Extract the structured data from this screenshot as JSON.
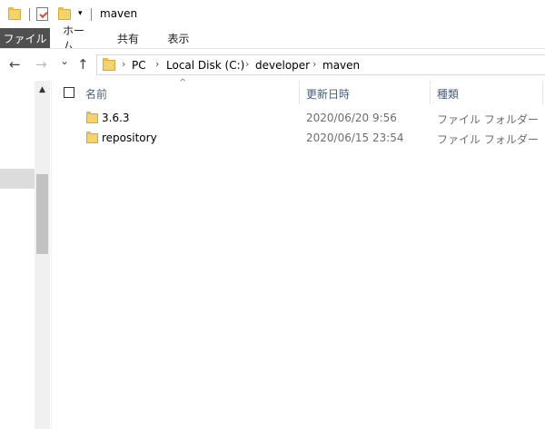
{
  "window": {
    "title": "maven",
    "quick_access_arrow": "▾"
  },
  "ribbon": {
    "tabs": [
      {
        "label": "ファイル"
      },
      {
        "label": "ホーム"
      },
      {
        "label": "共有"
      },
      {
        "label": "表示"
      }
    ]
  },
  "navigation": {
    "back_icon": "←",
    "forward_icon": "→",
    "recent_icon": "⌄",
    "up_icon": "↑",
    "breadcrumbs": [
      "PC",
      "Local Disk (C:)",
      "developer",
      "maven"
    ]
  },
  "list": {
    "columns": {
      "name": "名前",
      "modified": "更新日時",
      "type": "種類"
    },
    "sort_indicator": "^",
    "rows": [
      {
        "name": "3.6.3",
        "modified": "2020/06/20 9:56",
        "type": "ファイル フォルダー"
      },
      {
        "name": "repository",
        "modified": "2020/06/15 23:54",
        "type": "ファイル フォルダー"
      }
    ]
  },
  "colors": {
    "file_tab_bg": "#505050",
    "folder_yellow": "#f5d36c",
    "header_text": "#4c607a"
  }
}
